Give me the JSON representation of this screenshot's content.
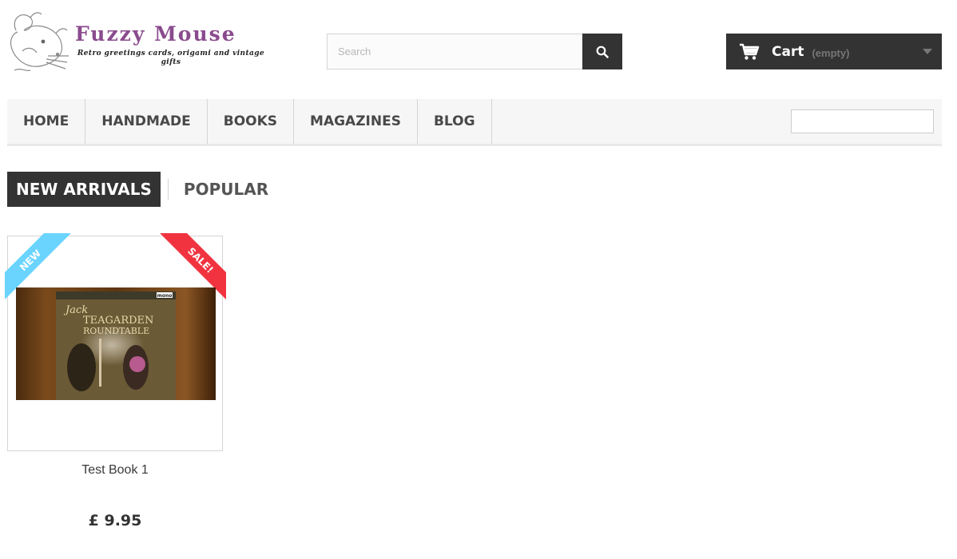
{
  "header": {
    "logo": {
      "title": "Fuzzy Mouse",
      "subtitle": "Retro greetings cards, origami and vintage gifts"
    },
    "search": {
      "placeholder": "Search",
      "button_icon": "search-icon"
    },
    "cart": {
      "label": "Cart",
      "status": "(empty)",
      "icon": "shopping-cart-icon"
    }
  },
  "nav": {
    "items": [
      {
        "label": "HOME"
      },
      {
        "label": "HANDMADE"
      },
      {
        "label": "BOOKS"
      },
      {
        "label": "MAGAZINES"
      },
      {
        "label": "BLOG"
      }
    ]
  },
  "tabs": [
    {
      "label": "NEW ARRIVALS",
      "active": true
    },
    {
      "label": "POPULAR",
      "active": false
    }
  ],
  "products": [
    {
      "name": "Test Book 1",
      "price": "£ 9.95",
      "badges": [
        "NEW",
        "SALE!"
      ],
      "image_text": {
        "line1": "Jack",
        "line2": "TEAGARDEN",
        "line3": "ROUNDTABLE",
        "label": "mono"
      }
    }
  ],
  "colors": {
    "dark": "#333333",
    "nav_bg": "#f6f6f6",
    "logo_purple": "#8a4b8e",
    "badge_new": "#6ad4ff",
    "badge_sale": "#f13340"
  }
}
